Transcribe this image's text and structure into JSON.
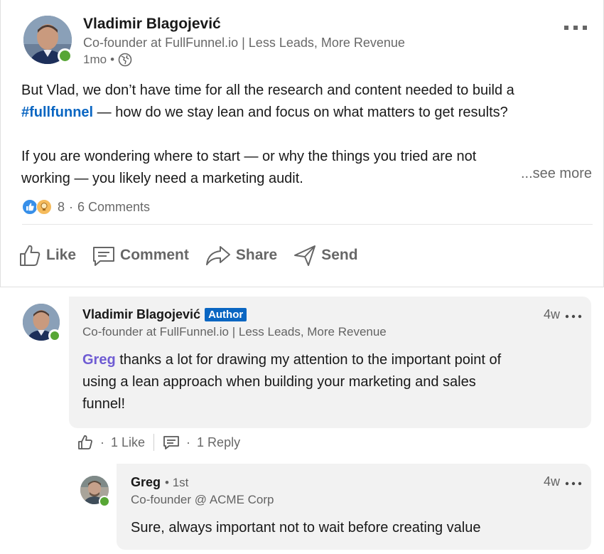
{
  "post": {
    "author": {
      "name": "Vladimir Blagojević",
      "headline": "Co-founder at FullFunnel.io | Less Leads, More Revenue",
      "time": "1mo",
      "separator": "•"
    },
    "menu_icon": "more-horizontal-icon",
    "text": {
      "line1_before": "But Vlad, we don’t have time for all the research and content needed to build a",
      "hashtag": "#fullfunnel",
      "line2_after": " — how do we stay lean and focus on what matters to get results?",
      "para2_line1": "If you are wondering where to start — or why the things you tried are not",
      "para2_line2": "working — you likely need a marketing audit."
    },
    "see_more": "...see more",
    "reactions": {
      "icons": [
        "like-reaction-icon",
        "insightful-reaction-icon"
      ],
      "count": "8",
      "separator": "·",
      "comments": "6 Comments"
    },
    "actions": [
      {
        "label": "Like",
        "icon": "thumbs-up-icon"
      },
      {
        "label": "Comment",
        "icon": "comment-icon"
      },
      {
        "label": "Share",
        "icon": "share-arrow-icon"
      },
      {
        "label": "Send",
        "icon": "send-icon"
      }
    ]
  },
  "comments": [
    {
      "name": "Vladimir Blagojević",
      "badge": "Author",
      "headline": "Co-founder at FullFunnel.io | Less Leads, More Revenue",
      "time": "4w",
      "mention": "Greg",
      "text_after_mention": " thanks a lot for drawing my attention to the important point of",
      "line2": "using a lean approach when building your marketing and sales",
      "line3": "funnel!",
      "sep": "·",
      "likes": "1 Like",
      "replies": "1 Reply"
    },
    {
      "name": "Greg",
      "degree": "• 1st",
      "headline": "Co-founder @ ACME Corp",
      "time": "4w",
      "text": "Sure, always important not to wait before creating value"
    }
  ],
  "colors": {
    "link_blue": "#0a66c2",
    "mention_purple": "#6f5cd3",
    "presence_green": "#57a635",
    "bubble_bg": "#f2f2f2"
  }
}
